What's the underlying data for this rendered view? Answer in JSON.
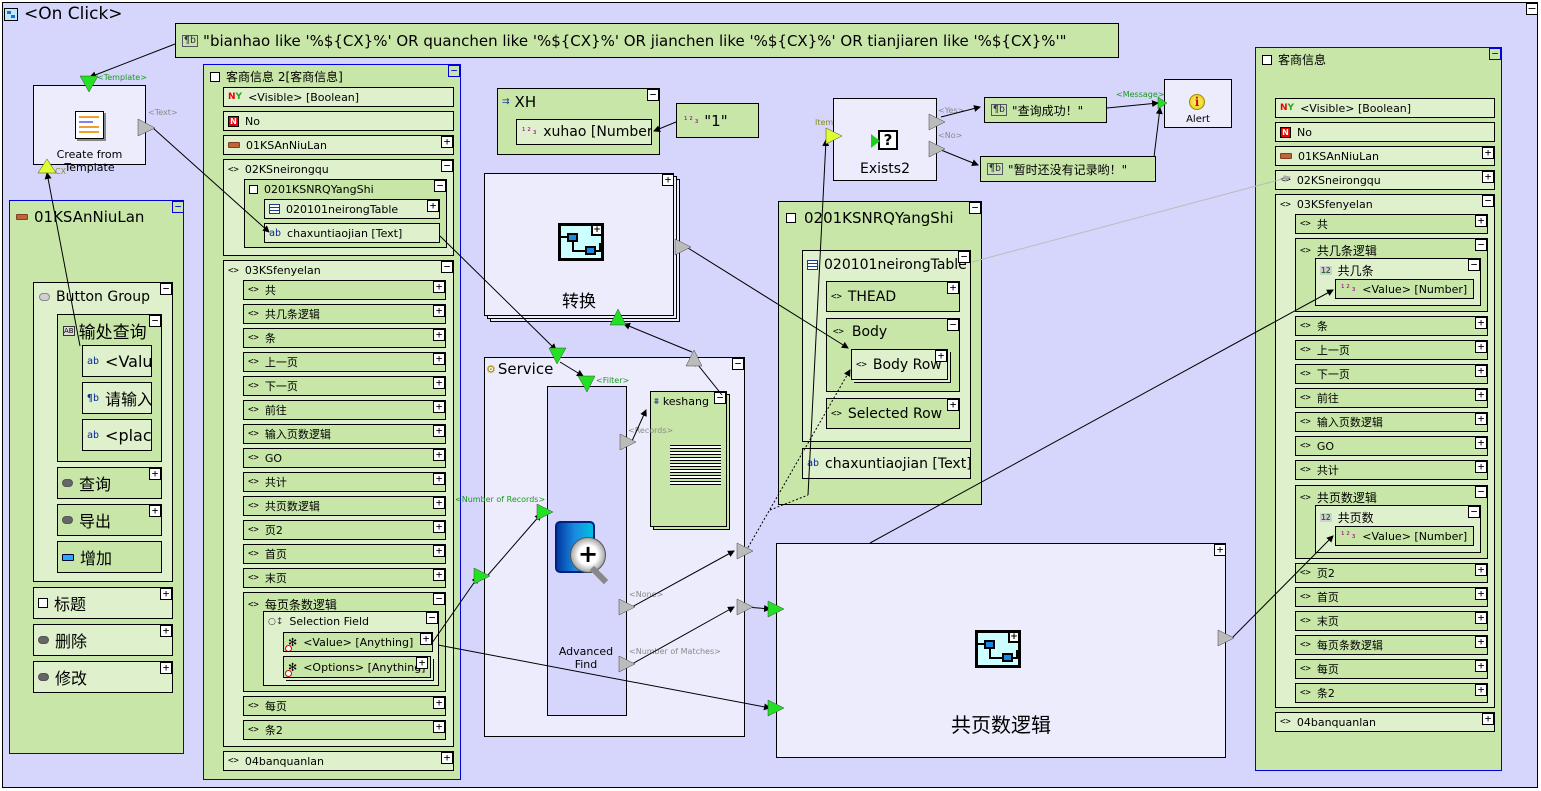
{
  "canvas": {
    "title": "<On Click>"
  },
  "template_expr": {
    "text": "\"bianhao like '%${CX}%' OR quanchen like '%${CX}%' OR jianchen like '%${CX}%'  OR tianjiaren like '%${CX}%'\""
  },
  "create_template": {
    "label": "Create from Template",
    "port_template": "<Template>",
    "port_text": "<Text>",
    "port_cx": "CX"
  },
  "left_panel": {
    "title": "01KSAnNiuLan",
    "button_group": {
      "title": "Button Group",
      "input_group": {
        "title": "输处查询",
        "items": [
          "<Value",
          "请输入",
          "<place"
        ]
      },
      "buttons": [
        "查询",
        "导出",
        "增加"
      ]
    },
    "items": [
      "标题",
      "删除",
      "修改"
    ]
  },
  "middle_panel": {
    "title": "客商信息 2[客商信息]",
    "visible": "<Visible> [Boolean]",
    "no": "No",
    "an_niu_lan": "01KSAnNiuLan",
    "neirongqu": {
      "title": "02KSneirongqu",
      "yangshi": {
        "title": "0201KSNRQYangShi",
        "table": "020101neirongTable",
        "field": "chaxuntiaojian [Text]"
      }
    },
    "fenyelan": {
      "title": "03KSfenyelan",
      "items": [
        "共",
        "共几条逻辑",
        "条",
        "上一页",
        "下一页",
        "前往",
        "输入页数逻辑",
        "GO",
        "共计",
        "共页数逻辑",
        "页2",
        "首页",
        "末页"
      ],
      "per_page_logic": {
        "title": "每页条数逻辑",
        "selection_field": {
          "title": "Selection Field",
          "value": "<Value> [Anything]",
          "options": "<Options> [Anything]"
        }
      },
      "tail_items": [
        "每页",
        "条2"
      ]
    },
    "banquanlan": "04banquanlan"
  },
  "xh": {
    "title": "XH",
    "field": "xuhao [Number]",
    "const": "\"1\""
  },
  "transform": {
    "label": "转换"
  },
  "service": {
    "title": "Service",
    "port_filter": "<Filter>",
    "port_records": "<Records>",
    "port_number_records": "<Number of Records>",
    "port_none": "<None>",
    "port_number_matches": "<Number of Matches>",
    "advanced_find": "Advanced Find",
    "keshang": "keshang"
  },
  "exists": {
    "label": "Exists2",
    "port_item": "Item",
    "port_yes": "<Yes>",
    "port_no": "<No>"
  },
  "messages": {
    "success": "\"查询成功！\"",
    "empty": "\"暂时还没有记录哟！\""
  },
  "alert": {
    "label": "Alert",
    "port_message": "<Message>"
  },
  "yangshi_panel": {
    "title": "0201KSNRQYangShi",
    "table": "020101neirongTable",
    "thead": "THEAD",
    "body": "Body",
    "body_row": "Body Row",
    "selected_row": "Selected Row",
    "field": "chaxuntiaojian [Text]"
  },
  "total_pages_logic": {
    "label": "共页数逻辑"
  },
  "right_panel": {
    "title": "客商信息",
    "visible": "<Visible> [Boolean]",
    "no": "No",
    "an_niu_lan": "01KSAnNiuLan",
    "neirongqu": "02KSneirongqu",
    "fenyelan": {
      "title": "03KSfenyelan",
      "gong": "共",
      "count_logic": {
        "title": "共几条逻辑",
        "sub": "共几条",
        "value": "<Value> [Number]"
      },
      "mid_items": [
        "条",
        "上一页",
        "下一页",
        "前往",
        "输入页数逻辑",
        "GO",
        "共计"
      ],
      "pages_logic": {
        "title": "共页数逻辑",
        "sub": "共页数",
        "value": "<Value> [Number]"
      },
      "tail_items": [
        "页2",
        "首页",
        "末页",
        "每页条数逻辑",
        "每页",
        "条2"
      ]
    },
    "banquanlan": "04banquanlan"
  }
}
